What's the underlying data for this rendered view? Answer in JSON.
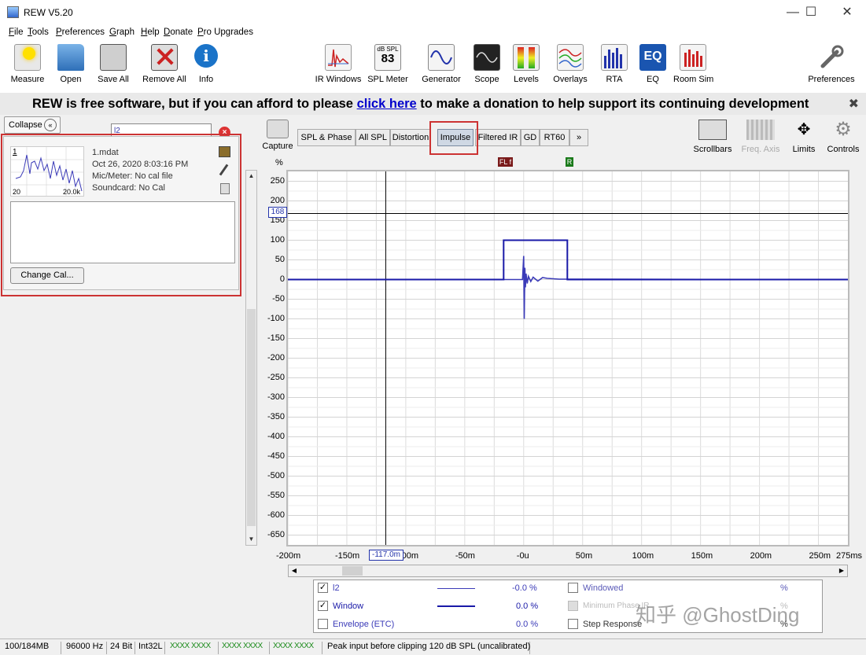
{
  "window": {
    "title": "REW V5.20",
    "minimize": "—",
    "maximize": "☐",
    "close": "✕"
  },
  "menu": [
    "File",
    "Tools",
    "Preferences",
    "Graph",
    "Help",
    "Donate",
    "Pro Upgrades"
  ],
  "toolbar": {
    "measure": "Measure",
    "open": "Open",
    "save_all": "Save All",
    "remove_all": "Remove All",
    "info": "Info",
    "ir_windows": "IR Windows",
    "spl_meter": "SPL Meter",
    "spl_meter_unit": "dB SPL",
    "spl_meter_value": "83",
    "generator": "Generator",
    "scope": "Scope",
    "levels": "Levels",
    "overlays": "Overlays",
    "rta": "RTA",
    "eq": "EQ",
    "eq_icon_text": "EQ",
    "room_sim": "Room Sim",
    "preferences": "Preferences"
  },
  "banner": {
    "before": "REW is free software, but if you can afford to please ",
    "link": "click here",
    "after": " to make a donation to help support its continuing development",
    "close": "✖"
  },
  "left_panel": {
    "collapse_label": "Collapse",
    "collapse_icon": "«",
    "search_value": "l2",
    "clear": "×",
    "measurement": {
      "index": "1",
      "thumb_x_min": "20",
      "thumb_x_max": "20.0k",
      "file": "1.mdat",
      "date": "Oct 26, 2020 8:03:16 PM",
      "mic": "Mic/Meter: No cal file",
      "soundcard": "Soundcard: No Cal"
    },
    "change_cal": "Change Cal..."
  },
  "graph": {
    "capture": "Capture",
    "tabs": [
      "SPL & Phase",
      "All SPL",
      "Distortion",
      "Impulse",
      "Filtered IR",
      "GD",
      "RT60",
      "»"
    ],
    "active_tab": "Impulse",
    "controls": {
      "scrollbars": "Scrollbars",
      "freq_axis": "Freq. Axis",
      "limits": "Limits",
      "controls": "Controls"
    },
    "y_unit": "%",
    "cursor_y_readout": "168",
    "cursor_x_readout": "-117.0m",
    "markers": {
      "fl": "FL",
      "f": "f",
      "r": "R"
    },
    "y_ticks": [
      "250",
      "200",
      "150",
      "100",
      "50",
      "0",
      "-50",
      "-100",
      "-150",
      "-200",
      "-250",
      "-300",
      "-350",
      "-400",
      "-450",
      "-500",
      "-550",
      "-600",
      "-650"
    ],
    "x_ticks": [
      "-200m",
      "-150m",
      "-100m",
      "-50m",
      "-0u",
      "50m",
      "100m",
      "150m",
      "200m",
      "250m",
      "275ms"
    ]
  },
  "chart_data": {
    "type": "line",
    "xlabel": "",
    "ylabel": "%",
    "xlim": [
      -200,
      275
    ],
    "ylim": [
      -675,
      275
    ],
    "grid": true,
    "series": [
      {
        "name": "l2",
        "color": "#3b3bb8",
        "x": [
          -200,
          -1,
          0,
          0.5,
          1,
          1.5,
          2,
          3,
          4,
          6,
          8,
          12,
          16,
          20,
          30,
          275
        ],
        "y": [
          0,
          0,
          60,
          -100,
          30,
          -20,
          15,
          -10,
          8,
          -5,
          6,
          -4,
          5,
          3,
          1,
          0
        ]
      },
      {
        "name": "Window",
        "color": "#1a1aa8",
        "x": [
          -200,
          -17,
          -17,
          37,
          37,
          275
        ],
        "y": [
          0,
          0,
          100,
          100,
          0,
          0
        ]
      }
    ],
    "cursor": {
      "x": -117,
      "y": 168
    }
  },
  "legend": {
    "rows": [
      {
        "label": "l2",
        "checked": true,
        "value": "-0.0 %"
      },
      {
        "label": "Window",
        "checked": true,
        "value": "0.0 %"
      },
      {
        "label": "Envelope (ETC)",
        "checked": false,
        "value": "0.0 %"
      }
    ],
    "rows_right": [
      {
        "label": "Windowed",
        "checked": false,
        "value": "%"
      },
      {
        "label": "Minimum Phase IR",
        "checked": false,
        "value": "%"
      },
      {
        "label": "Step Response",
        "checked": false,
        "value": "%"
      }
    ],
    "check_mark": "✓"
  },
  "status": {
    "memory": "100/184MB",
    "rate": "96000 Hz",
    "bits": "24 Bit",
    "format": "Int32L",
    "meter1": "XXXX XXXX",
    "meter2": "XXXX XXXX",
    "meter3": "XXXX XXXX",
    "peak": "Peak input before clipping 120 dB SPL (uncalibrated)"
  },
  "watermark": "知乎 @GhostDing"
}
